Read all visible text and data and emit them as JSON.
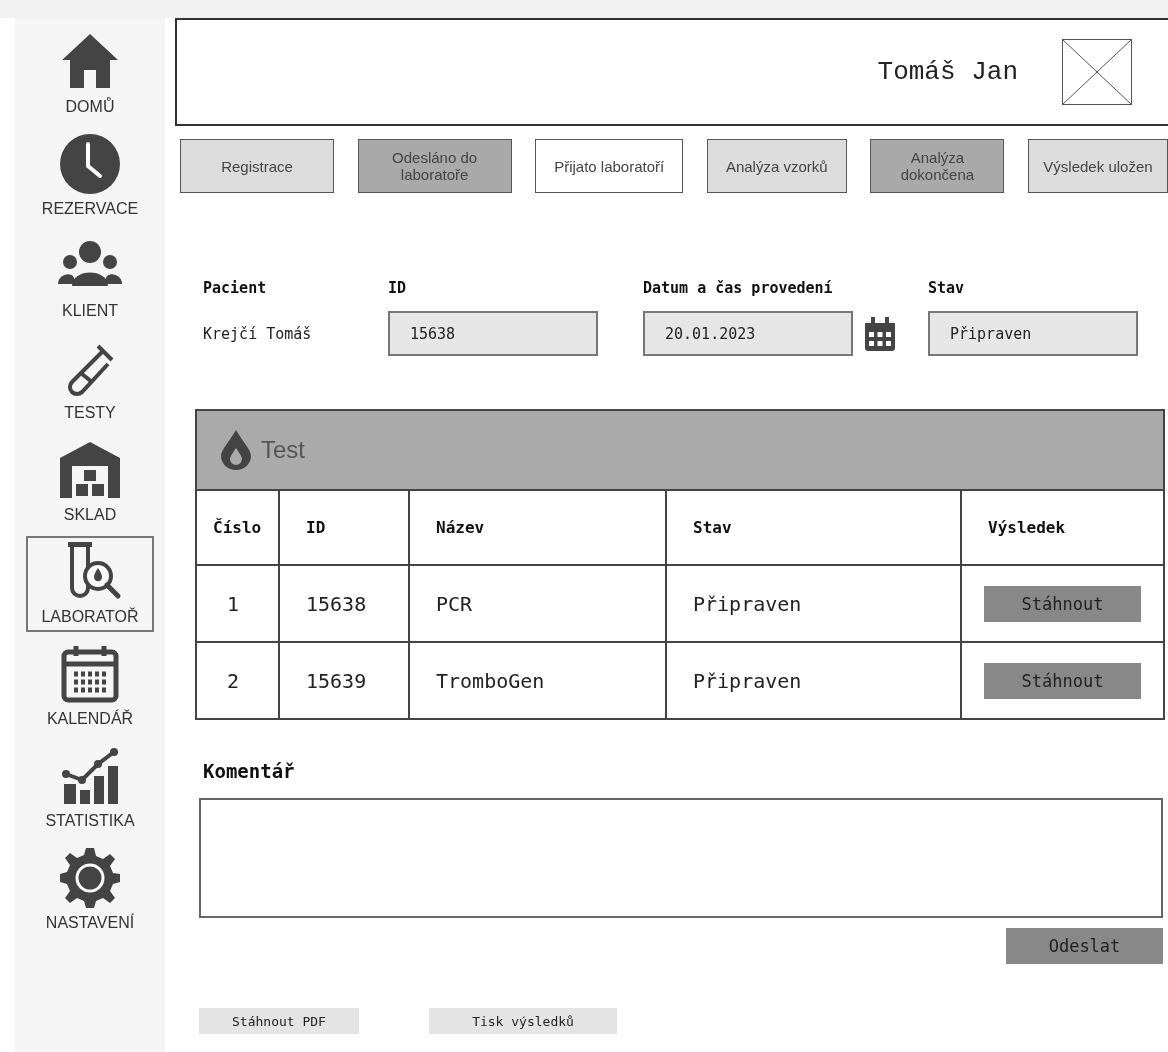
{
  "sidebar": {
    "items": [
      {
        "label": "DOMŮ",
        "selected": false
      },
      {
        "label": "REZERVACE",
        "selected": false
      },
      {
        "label": "KLIENT",
        "selected": false
      },
      {
        "label": "TESTY",
        "selected": false
      },
      {
        "label": "SKLAD",
        "selected": false
      },
      {
        "label": "LABORATOŘ",
        "selected": true
      },
      {
        "label": "KALENDÁŘ",
        "selected": false
      },
      {
        "label": "STATISTIKA",
        "selected": false
      },
      {
        "label": "NASTAVENÍ",
        "selected": false
      }
    ]
  },
  "header": {
    "user_name": "Tomáš Jan"
  },
  "steps": [
    {
      "label": "Registrace",
      "color": "#dcdcdc"
    },
    {
      "label": "Odesláno do laboratoře",
      "color": "#a9a9a9"
    },
    {
      "label": "Přijato laboratoří",
      "color": "#ffffff"
    },
    {
      "label": "Analýza vzorků",
      "color": "#dcdcdc"
    },
    {
      "label": "Analýza dokončena",
      "color": "#a9a9a9"
    },
    {
      "label": "Výsledek uložen",
      "color": "#dcdcdc"
    }
  ],
  "details": {
    "patient_label": "Pacient",
    "patient": "Krejčí Tomáš",
    "id_label": "ID",
    "id": "15638",
    "date_label": "Datum a čas provedení",
    "date": "20.01.2023",
    "status_label": "Stav",
    "status": "Připraven"
  },
  "table": {
    "title": "Test",
    "columns": [
      "Číslo",
      "ID",
      "Název",
      "Stav",
      "Výsledek"
    ],
    "rows": [
      {
        "number": "1",
        "id": "15638",
        "name": "PCR",
        "status": "Připraven",
        "action": "Stáhnout"
      },
      {
        "number": "2",
        "id": "15639",
        "name": "TromboGen",
        "status": "Připraven",
        "action": "Stáhnout"
      }
    ]
  },
  "comment": {
    "label": "Komentář",
    "submit": "Odeslat"
  },
  "footer_buttons": [
    "Stáhnout PDF",
    "Tisk výsledků"
  ]
}
